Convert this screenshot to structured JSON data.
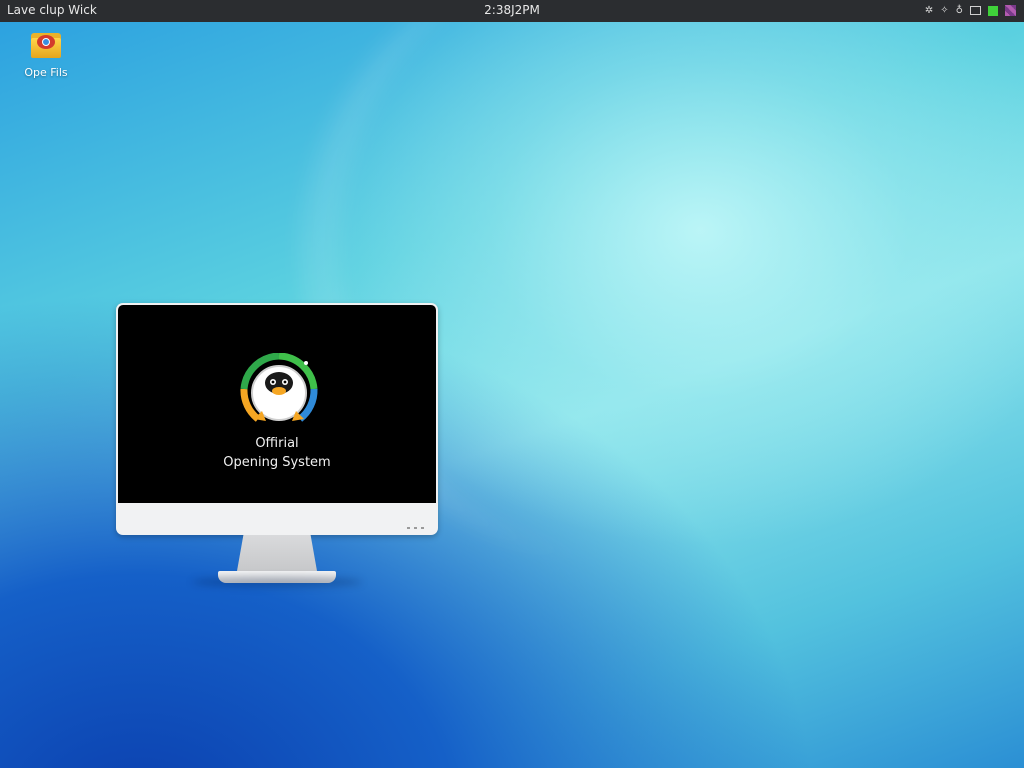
{
  "topbar": {
    "left_label": "Lave  clup Wick",
    "clock": "2:38J2PM",
    "tray_icons": [
      "network-icon",
      "volume-icon",
      "bell-icon",
      "battery-icon",
      "status-green-icon",
      "close-icon"
    ]
  },
  "desktop_icons": [
    {
      "label": "Ope Fils",
      "icon": "folder-icon"
    }
  ],
  "monitor": {
    "line1": "Offirial",
    "line2": "Opening System"
  },
  "colors": {
    "topbar_bg": "#2b2d30",
    "screen_bg": "#000000",
    "accent_green": "#3fd13a",
    "logo_orange": "#f5a623"
  }
}
